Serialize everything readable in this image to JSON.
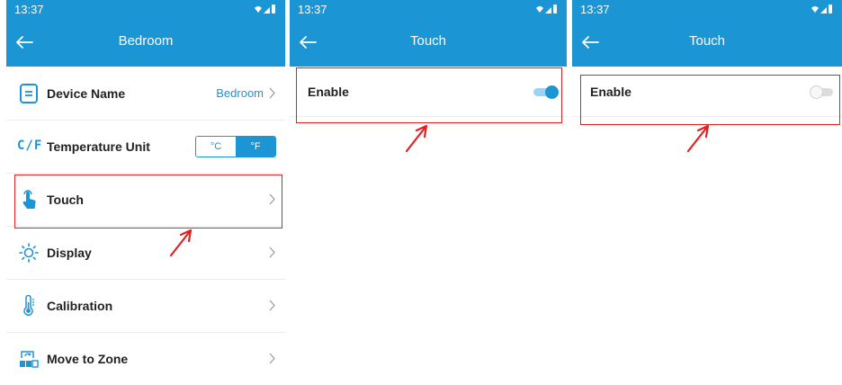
{
  "colors": {
    "accent": "#1b95d3",
    "highlight": "#e02020",
    "divider": "#ececec"
  },
  "panel1": {
    "status_time": "13:37",
    "title": "Bedroom",
    "items": [
      {
        "label": "Device Name",
        "value": "Bedroom",
        "icon": "device-name-icon"
      },
      {
        "label": "Temperature Unit",
        "icon_text": "C/F",
        "units": [
          "°C",
          "°F"
        ],
        "selected_unit": "°F"
      },
      {
        "label": "Touch",
        "icon": "touch-hand-icon"
      },
      {
        "label": "Display",
        "icon": "sun-icon"
      },
      {
        "label": "Calibration",
        "icon": "thermometer-icon"
      },
      {
        "label": "Move to Zone",
        "icon": "zone-icon"
      }
    ]
  },
  "panel2": {
    "status_time": "13:37",
    "title": "Touch",
    "enable_label": "Enable",
    "enabled": true
  },
  "panel3": {
    "status_time": "13:37",
    "title": "Touch",
    "enable_label": "Enable",
    "enabled": false
  }
}
